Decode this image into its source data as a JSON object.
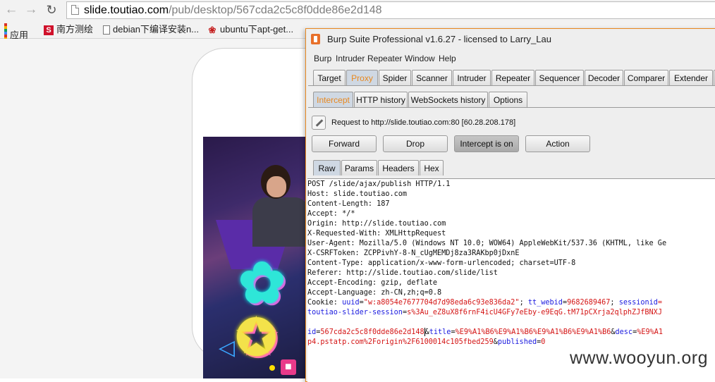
{
  "browser": {
    "url_host": "slide.toutiao.com",
    "url_path": "/pub/desktop/567cda2c5c8f0dde86e2d148",
    "bookmarks": [
      {
        "label": "应用",
        "icon": "apps-grid-icon"
      },
      {
        "label": "南方测绘",
        "icon": "s-logo-icon"
      },
      {
        "label": "debian下编译安装n...",
        "icon": "document-icon"
      },
      {
        "label": "ubuntu下apt-get...",
        "icon": "baidu-paw-icon"
      }
    ]
  },
  "burp": {
    "title": "Burp Suite Professional v1.6.27 - licensed to Larry_Lau",
    "menu": [
      "Burp",
      "Intruder",
      "Repeater",
      "Window",
      "Help"
    ],
    "main_tabs": [
      "Target",
      "Proxy",
      "Spider",
      "Scanner",
      "Intruder",
      "Repeater",
      "Sequencer",
      "Decoder",
      "Comparer",
      "Extender"
    ],
    "main_active": "Proxy",
    "proxy_tabs": [
      "Intercept",
      "HTTP history",
      "WebSockets history",
      "Options"
    ],
    "proxy_active": "Intercept",
    "request_info": "Request to http://slide.toutiao.com:80  [60.28.208.178]",
    "buttons": {
      "forward": "Forward",
      "drop": "Drop",
      "intercept": "Intercept is on",
      "action": "Action"
    },
    "view_tabs": [
      "Raw",
      "Params",
      "Headers",
      "Hex"
    ],
    "view_active": "Raw",
    "request": {
      "request_line": "POST /slide/ajax/publish HTTP/1.1",
      "headers": [
        "Host: slide.toutiao.com",
        "Content-Length: 187",
        "Accept: */*",
        "Origin: http://slide.toutiao.com",
        "X-Requested-With: XMLHttpRequest",
        "User-Agent: Mozilla/5.0 (Windows NT 10.0; WOW64) AppleWebKit/537.36 (KHTML, like Ge",
        "X-CSRFToken: ZCPPivhY-8-N_cUgMEMDj8za3RAKbp0jDxnE",
        "Content-Type: application/x-www-form-urlencoded; charset=UTF-8",
        "Referer: http://slide.toutiao.com/slide/list",
        "Accept-Encoding: gzip, deflate",
        "Accept-Language: zh-CN,zh;q=0.8"
      ],
      "cookie_prefix": "Cookie: ",
      "cookie_k1": "uuid",
      "cookie_v1": "\"w:a8054e7677704d7d98eda6c93e836da2\"",
      "cookie_k2": "tt_webid",
      "cookie_v2": "9682689467",
      "cookie_k3": "sessionid",
      "cookie_v3": "=",
      "cookie2_k": "toutiao-slider-session",
      "cookie2_v": "s%3Au_eZ8uX8f6rnF4icU4GFy7eEby-e9EqG.tM71pCXrja2qlphZJfBNXJ",
      "body_k1": "id",
      "body_v1": "567cda2c5c8f0dde86e2d148",
      "body_k2": "title",
      "body_v2": "%E9%A1%B6%E9%A1%B6%E9%A1%B6%E9%A1%B6",
      "body_k3": "desc",
      "body_v3": "%E9%A1",
      "body_line2_v": "p4.pstatp.com%2Forigin%2F6100014c105fbed259",
      "body_k4": "published",
      "body_v4": "0"
    }
  },
  "watermark": "www.wooyun.org",
  "colors": {
    "burp_accent": "#e8881f",
    "param_name": "#1a1adf",
    "param_value": "#d41515"
  }
}
